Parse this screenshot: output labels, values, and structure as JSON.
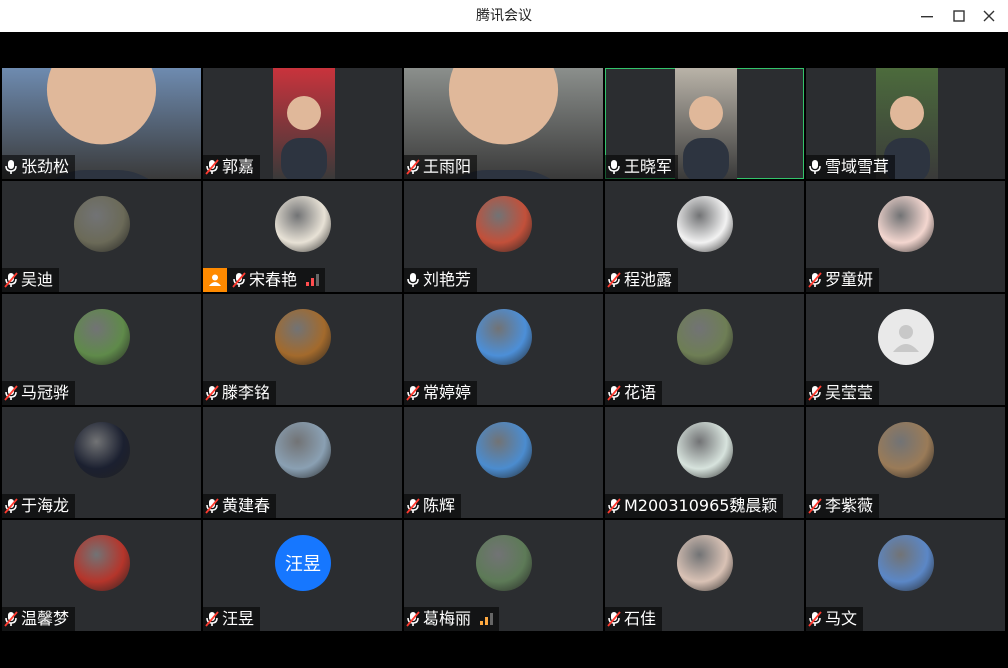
{
  "window": {
    "title": "腾讯会议"
  },
  "tiles": [
    {
      "name": "张劲松",
      "video": true,
      "mic": "on",
      "bg": "#6e8bb0"
    },
    {
      "name": "郭嘉",
      "video": true,
      "mic": "muted",
      "bg": "#c9333c"
    },
    {
      "name": "王雨阳",
      "video": true,
      "mic": "muted",
      "bg": "#8b8f8c"
    },
    {
      "name": "王晓军",
      "video": true,
      "mic": "on",
      "active": true,
      "bg": "#b9b3a8"
    },
    {
      "name": "雪域雪茸",
      "video": true,
      "mic": "on",
      "bg": "#4c6b3c"
    },
    {
      "name": "吴迪",
      "mic": "muted",
      "avatar": "#6b6a58"
    },
    {
      "name": "宋春艳",
      "mic": "muted",
      "avatar": "#e8e2d6",
      "host": true,
      "signal": {
        "level": 1,
        "color": "red"
      }
    },
    {
      "name": "刘艳芳",
      "mic": "on",
      "avatar": "#c2503a"
    },
    {
      "name": "程池露",
      "mic": "muted",
      "avatar": "#f2f2f2"
    },
    {
      "name": "罗童妍",
      "mic": "muted",
      "avatar": "#f3d6cf"
    },
    {
      "name": "马冠骅",
      "mic": "muted",
      "avatar": "#5f8a4a"
    },
    {
      "name": "滕李铭",
      "mic": "muted",
      "avatar": "#a36a2c"
    },
    {
      "name": "常婷婷",
      "mic": "muted",
      "avatar": "#4c8fd8"
    },
    {
      "name": "花语",
      "mic": "muted",
      "avatar": "#6e7e55"
    },
    {
      "name": "吴莹莹",
      "mic": "muted",
      "avatar": "#e5e5e5",
      "default": true
    },
    {
      "name": "于海龙",
      "mic": "muted",
      "avatar": "#1b2030"
    },
    {
      "name": "黄建春",
      "mic": "muted",
      "avatar": "#8aa0b3"
    },
    {
      "name": "陈辉",
      "mic": "muted",
      "avatar": "#4b8ccf"
    },
    {
      "name": "M200310965魏晨颖",
      "mic": "muted",
      "avatar": "#d7e3dd"
    },
    {
      "name": "李紫薇",
      "mic": "muted",
      "avatar": "#9a7b58"
    },
    {
      "name": "温馨梦",
      "mic": "muted",
      "avatar": "#b5352b"
    },
    {
      "name": "汪昱",
      "mic": "muted",
      "avatar_text": "汪昱"
    },
    {
      "name": "葛梅丽",
      "mic": "muted",
      "avatar": "#5d7a57",
      "signal": {
        "level": 1,
        "color": "orange"
      }
    },
    {
      "name": "石佳",
      "mic": "muted",
      "avatar": "#d9c2b5"
    },
    {
      "name": "马文",
      "mic": "muted",
      "avatar": "#5b87c6"
    }
  ]
}
